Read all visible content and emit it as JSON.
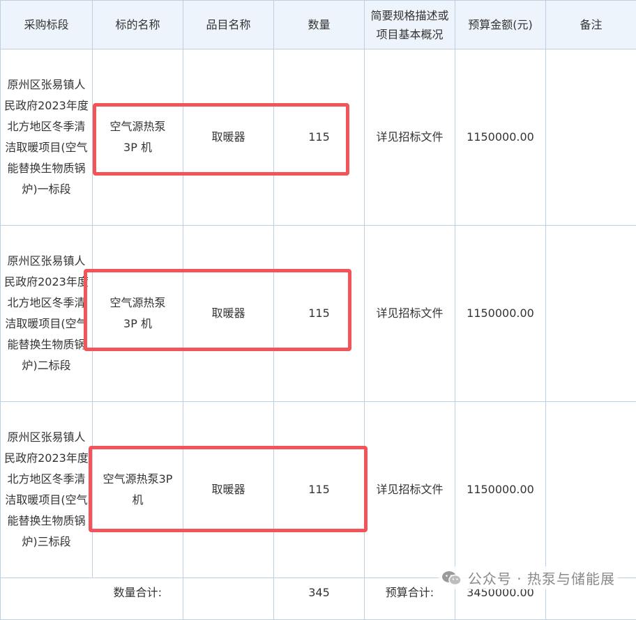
{
  "table": {
    "headers": [
      "采购标段",
      "标的名称",
      "品目名称",
      "数量",
      "简要规格描述或\n项目基本概况",
      "预算金额(元)",
      "备注"
    ],
    "rows": [
      {
        "section": "原州区张易镇人民政府2023年度北方地区冬季清洁取暖项目(空气能替换生物质锅炉)一标段",
        "name": "空气源热泵\n3P 机",
        "item": "取暖器",
        "qty": "115",
        "desc": "详见招标文件",
        "budget": "1150000.00",
        "note": ""
      },
      {
        "section": "原州区张易镇人民政府2023年度北方地区冬季清洁取暖项目(空气能替换生物质锅炉)二标段",
        "name": "空气源热泵\n3P 机",
        "item": "取暖器",
        "qty": "115",
        "desc": "详见招标文件",
        "budget": "1150000.00",
        "note": ""
      },
      {
        "section": "原州区张易镇人民政府2023年度北方地区冬季清洁取暖项目(空气能替换生物质锅炉)三标段",
        "name": "空气源热泵3P\n机",
        "item": "取暖器",
        "qty": "115",
        "desc": "详见招标文件",
        "budget": "1150000.00",
        "note": ""
      }
    ],
    "total": {
      "qty_label": "数量合计:",
      "qty_value": "345",
      "budget_label": "预算合计:",
      "budget_value": "3450000.00"
    }
  },
  "watermark": {
    "text": "公众号 · 热泵与储能展",
    "icon": "wechat-icon"
  },
  "colors": {
    "highlight": "#f2545a",
    "header_bg": "#eef4fb",
    "border": "#bcd0e2"
  }
}
